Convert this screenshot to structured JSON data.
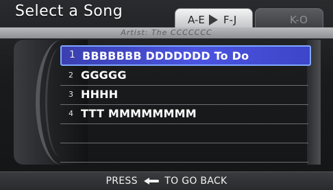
{
  "header": {
    "title": "Select a Song",
    "artist_line": "Artist: The CCCCCCC"
  },
  "tabs": {
    "active": {
      "label_start": "A-E",
      "label_next": "F-J"
    },
    "inactive": {
      "label": "K-O"
    }
  },
  "songs": [
    {
      "num": "1",
      "name": "BBBBBBB DDDDDDD To Do",
      "selected": true
    },
    {
      "num": "2",
      "name": "GGGGG",
      "selected": false
    },
    {
      "num": "3",
      "name": "HHHH",
      "selected": false
    },
    {
      "num": "4",
      "name": "TTT MMMMMMMM",
      "selected": false
    }
  ],
  "footer": {
    "press": "PRESS",
    "back_icon": "back-arrow-icon",
    "action": "TO GO BACK"
  },
  "colors": {
    "highlight": "#4b54e0",
    "background": "#1b1b1d"
  }
}
